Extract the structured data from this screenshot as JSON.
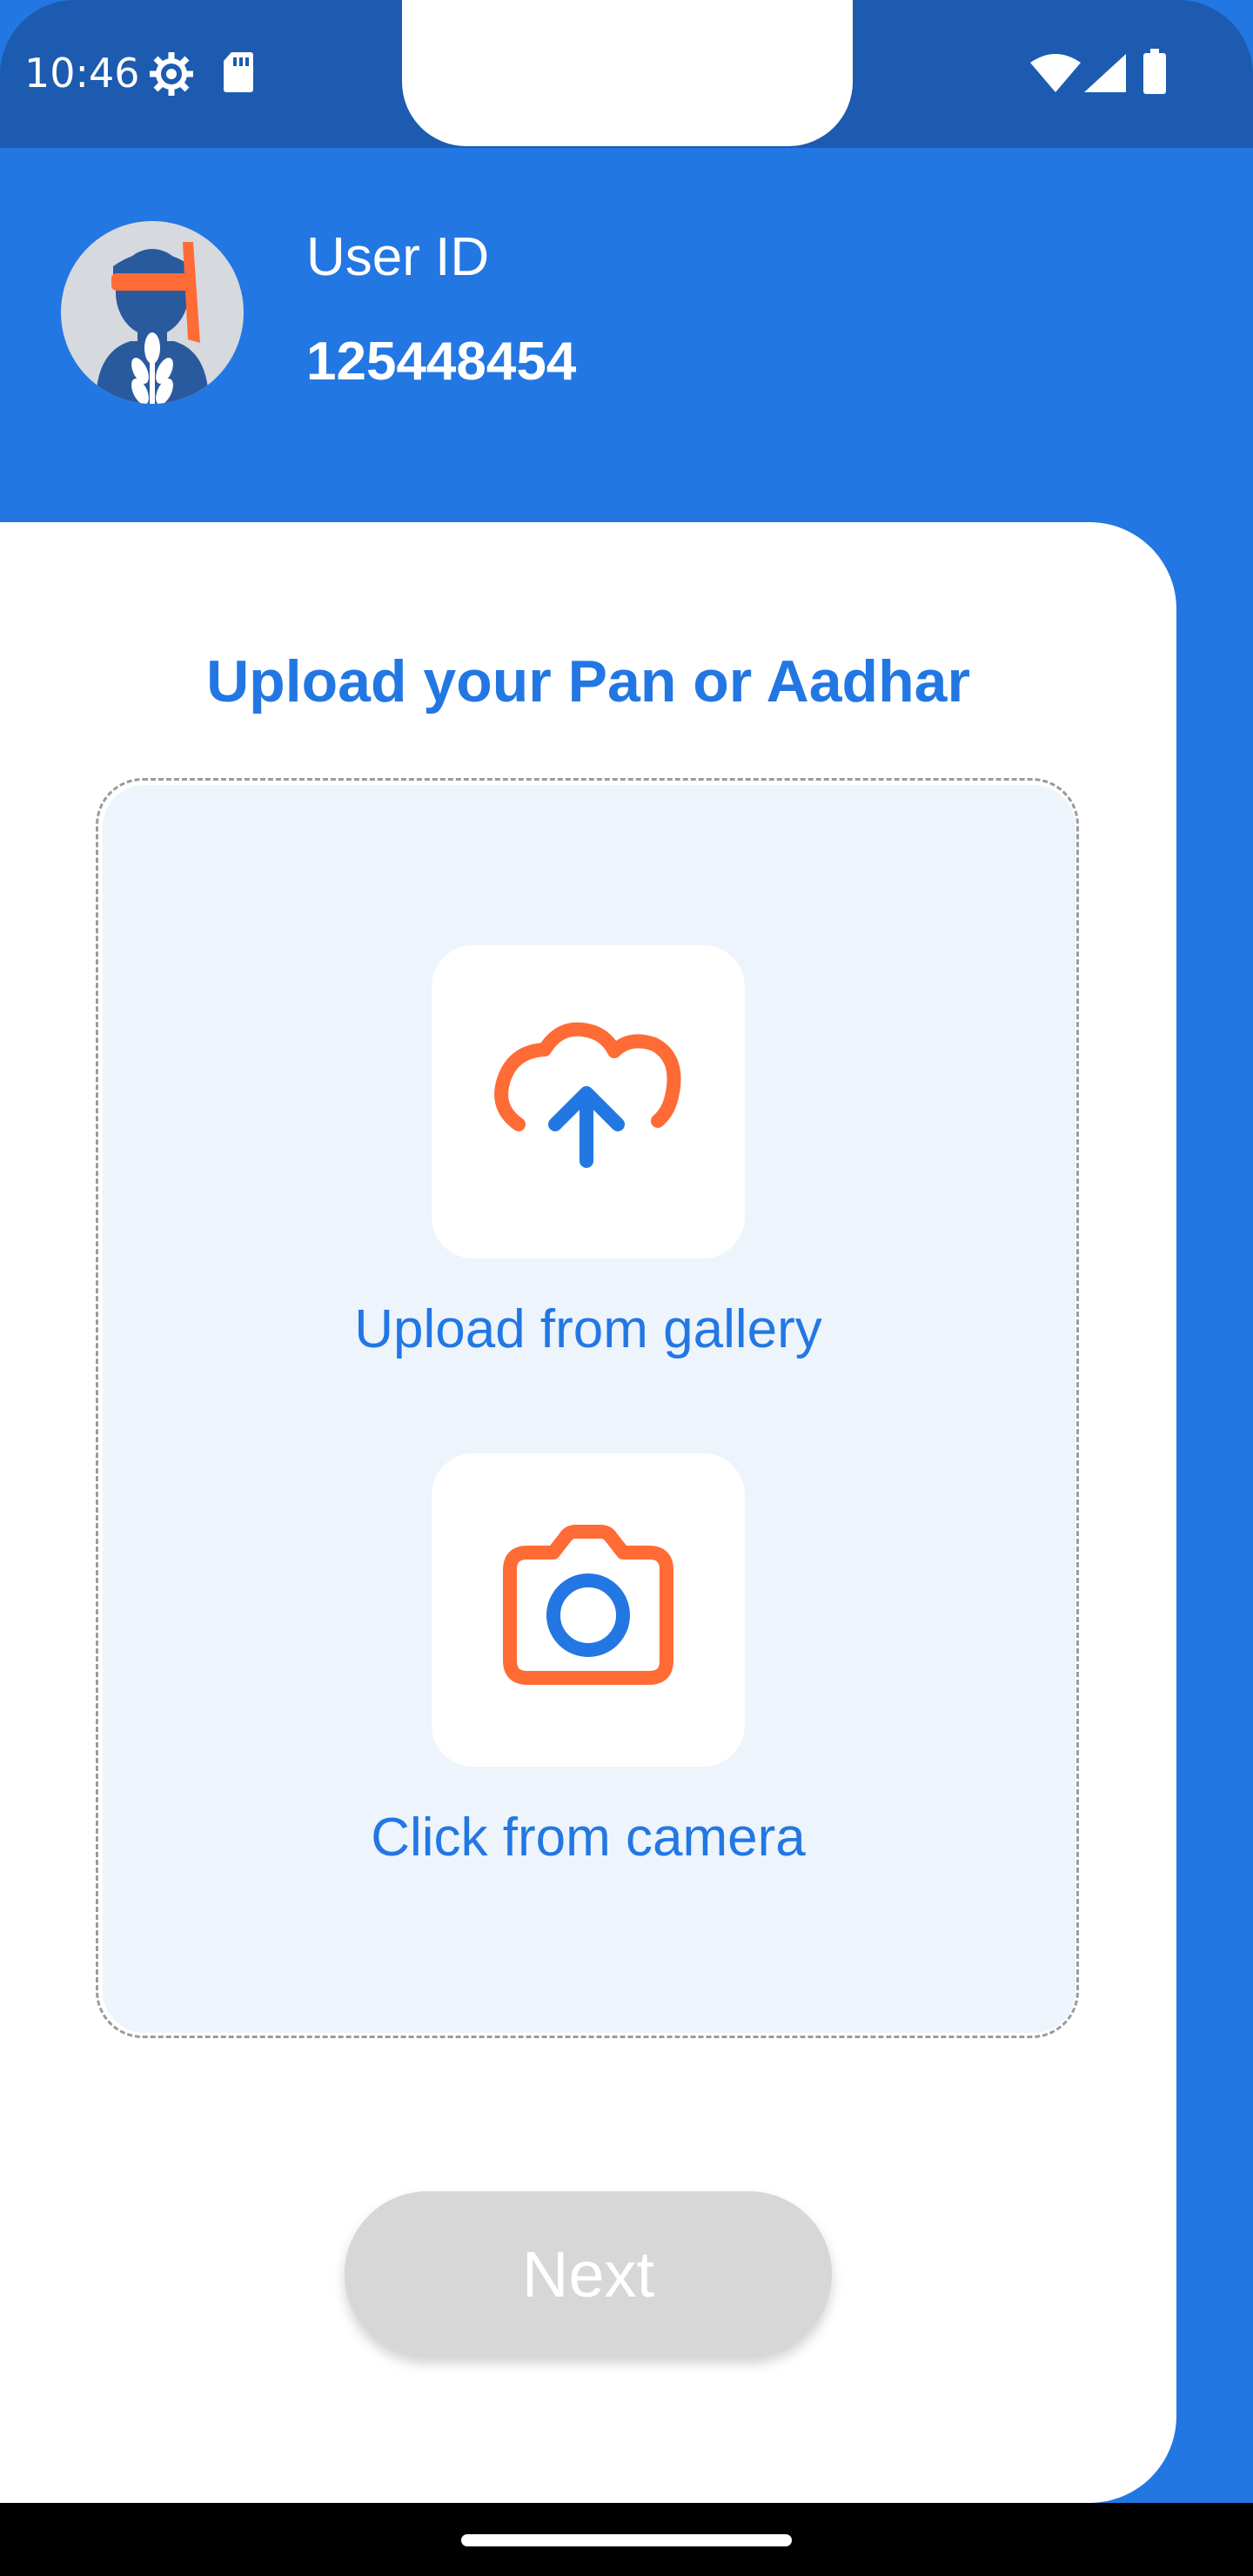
{
  "status_bar": {
    "time": "10:46",
    "icons": [
      "settings-gear-icon",
      "sd-card-icon",
      "wifi-icon",
      "signal-icon",
      "battery-icon"
    ]
  },
  "header": {
    "user_id_label": "User ID",
    "user_id_value": "125448454",
    "avatar_icon": "farmer-avatar-icon"
  },
  "upload": {
    "title": "Upload your Pan or Aadhar",
    "gallery_label": "Upload from gallery",
    "gallery_icon": "cloud-upload-icon",
    "camera_label": "Click from camera",
    "camera_icon": "camera-icon"
  },
  "actions": {
    "next_label": "Next",
    "next_enabled": false
  },
  "colors": {
    "primary_blue": "#2277e3",
    "status_bar_blue": "#1c5bb0",
    "accent_orange": "#ff6b35",
    "tile_background": "#edf4fc",
    "disabled_button": "#d7d7d7"
  }
}
